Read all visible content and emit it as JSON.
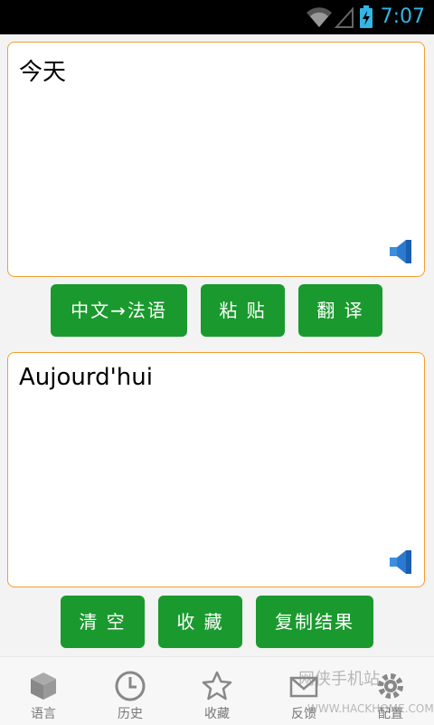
{
  "status": {
    "time": "7:07"
  },
  "input": {
    "text": "今天"
  },
  "buttons": {
    "language": "中文→法语",
    "paste": "粘 贴",
    "translate": "翻 译",
    "clear": "清 空",
    "favorite": "收 藏",
    "copy": "复制结果"
  },
  "output": {
    "text": "Aujourd'hui"
  },
  "nav": {
    "items": [
      {
        "label": "语言",
        "icon": "cube-icon"
      },
      {
        "label": "历史",
        "icon": "clock-icon"
      },
      {
        "label": "收藏",
        "icon": "star-icon"
      },
      {
        "label": "反馈",
        "icon": "mail-icon"
      },
      {
        "label": "配置",
        "icon": "gear-icon"
      }
    ]
  },
  "watermark": {
    "text": "网侠手机站",
    "url": "WWW.HACKHOME.COM"
  },
  "colors": {
    "accent_green": "#1a9a2e",
    "border_orange": "#f0a030",
    "status_blue": "#33b5e5"
  }
}
